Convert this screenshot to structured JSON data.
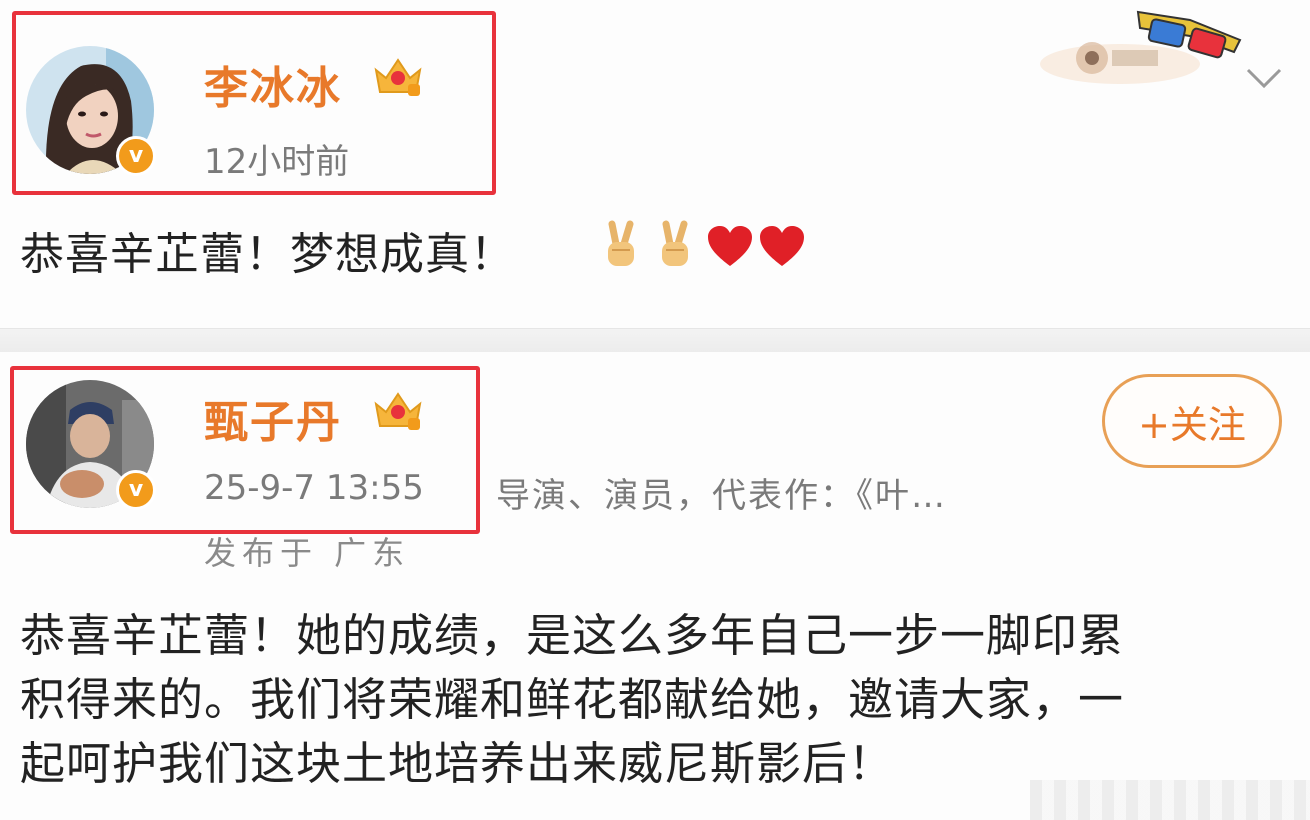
{
  "posts": [
    {
      "author": "李冰冰",
      "time": "12小时前",
      "content": "恭喜辛芷蕾！梦想成真！",
      "emojis": [
        "victory-hand",
        "victory-hand",
        "red-heart",
        "red-heart"
      ]
    },
    {
      "author": "甄子丹",
      "time": "25-9-7 13:55",
      "description": "导演、演员，代表作：《叶…",
      "location": "发布于 广东",
      "follow_label": "+关注",
      "content_lines": [
        "恭喜辛芷蕾！她的成绩，是这么多年自己一步一脚印累",
        "积得来的。我们将荣耀和鲜花都献给她，邀请大家，一",
        "起呵护我们这块土地培养出来威尼斯影后！"
      ]
    }
  ],
  "verified_mark": "v",
  "colors": {
    "name": "#e8792a",
    "highlight": "#e8323c",
    "verified": "#f29b1b",
    "follow_border": "#e8a056"
  },
  "icons": [
    "crown-badge-icon",
    "verified-badge-icon",
    "3d-glasses-sticker-icon",
    "chevron-down-icon",
    "victory-hand-icon",
    "heart-icon"
  ]
}
